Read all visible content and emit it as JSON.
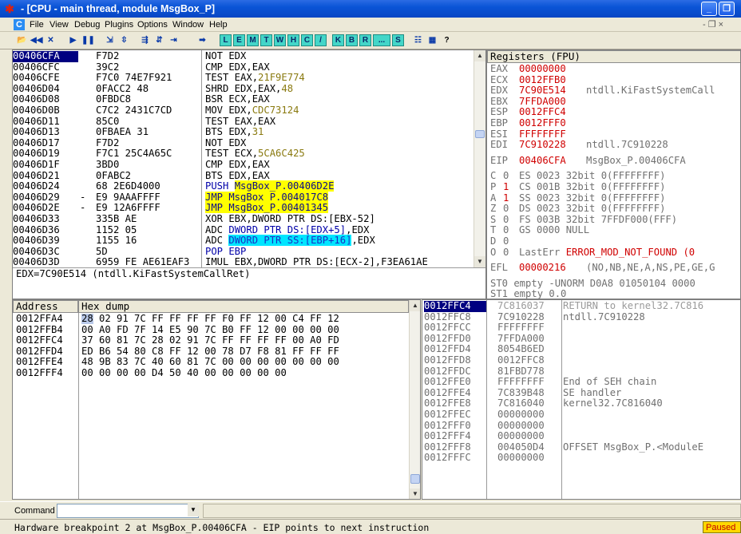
{
  "window": {
    "title": "- [CPU - main thread, module MsgBox_P]",
    "minimize_glyph": "_",
    "restore_glyph": "❐",
    "close_glyph": "✕",
    "app_icon_glyph": "✱"
  },
  "menu": {
    "items": [
      "File",
      "View",
      "Debug",
      "Plugins",
      "Options",
      "Window",
      "Help"
    ],
    "right_controls": "- ❐ ×"
  },
  "toolbar": {
    "buttons": [
      "open",
      "restart",
      "close",
      "run",
      "pause",
      "step-into",
      "step-over",
      "trace-into",
      "trace-over",
      "execute-till-return",
      "go-to"
    ],
    "glyphs": [
      "📂",
      "◀◀",
      "✕",
      "▶",
      "❚❚",
      "⇲",
      "⇳",
      "⇶",
      "⇵",
      "⇥",
      "➡"
    ],
    "letters": [
      "L",
      "E",
      "M",
      "T",
      "W",
      "H",
      "C",
      "/",
      "K",
      "B",
      "R",
      "...",
      "S"
    ],
    "extra_glyphs": [
      "☷",
      "▦",
      "?"
    ]
  },
  "disasm": {
    "addresses": [
      "00406CFA",
      "00406CFC",
      "00406CFE",
      "00406D04",
      "00406D08",
      "00406D0B",
      "00406D11",
      "00406D13",
      "00406D17",
      "00406D19",
      "00406D1F",
      "00406D21",
      "00406D24",
      "00406D29",
      "00406D2E",
      "00406D33",
      "00406D36",
      "00406D39",
      "00406D3C",
      "00406D3D"
    ],
    "jump_marks": [
      "",
      "",
      "",
      "",
      "",
      "",
      "",
      "",
      "",
      "",
      "",
      "",
      "",
      "-",
      "-",
      "",
      "",
      "",
      "",
      ""
    ],
    "hex": [
      "F7D2",
      "39C2",
      "F7C0 74E7F921",
      "0FACC2 48",
      "0FBDC8",
      "C7C2 2431C7CD",
      "85C0",
      "0FBAEA 31",
      "F7D2",
      "F7C1 25C4A65C",
      "3BD0",
      "0FABC2",
      "68 2E6D4000",
      "E9 9AAAFFFF",
      "E9 12A6FFFF",
      "335B AE",
      "1152 05",
      "1155 16",
      "5D",
      "6959 FE AE61EAF3"
    ],
    "instructions": [
      [
        {
          "t": "NOT EDX"
        }
      ],
      [
        {
          "t": "CMP EDX,EAX"
        }
      ],
      [
        {
          "t": "TEST EAX,"
        },
        {
          "t": "21F9E774",
          "c": "olive"
        }
      ],
      [
        {
          "t": "SHRD EDX,EAX,"
        },
        {
          "t": "48",
          "c": "olive"
        }
      ],
      [
        {
          "t": "BSR ECX,EAX"
        }
      ],
      [
        {
          "t": "MOV EDX,"
        },
        {
          "t": "CDC73124",
          "c": "olive"
        }
      ],
      [
        {
          "t": "TEST EAX,EAX"
        }
      ],
      [
        {
          "t": "BTS EDX,"
        },
        {
          "t": "31",
          "c": "olive"
        }
      ],
      [
        {
          "t": "NOT EDX"
        }
      ],
      [
        {
          "t": "TEST ECX,"
        },
        {
          "t": "5CA6C425",
          "c": "olive"
        }
      ],
      [
        {
          "t": "CMP EDX,EAX"
        }
      ],
      [
        {
          "t": "BTS EDX,EAX"
        }
      ],
      [
        {
          "t": "PUSH ",
          "c": "navy"
        },
        {
          "t": "MsgBox_P.00406D2E",
          "c": "hl-y"
        }
      ],
      [
        {
          "t": "JMP MsgBox_P.004017C8",
          "c": "hl-y"
        }
      ],
      [
        {
          "t": "JMP MsgBox_P.00401345",
          "c": "hl-y"
        }
      ],
      [
        {
          "t": "XOR EBX,DWORD PTR DS:[EBX-52]"
        }
      ],
      [
        {
          "t": "ADC "
        },
        {
          "t": "DWORD PTR DS:[EDX+5]",
          "c": "navy"
        },
        {
          "t": ",EDX"
        }
      ],
      [
        {
          "t": "ADC "
        },
        {
          "t": "DWORD PTR SS:[EBP+16]",
          "c": "hl-c"
        },
        {
          "t": ",EDX"
        }
      ],
      [
        {
          "t": "POP EBP",
          "c": "navy"
        }
      ],
      [
        {
          "t": "IMUL EBX,DWORD PTR DS:[ECX-2],F3EA61AE"
        }
      ]
    ],
    "info": "EDX=7C90E514 (ntdll.KiFastSystemCallRet)"
  },
  "registers": {
    "header": "Registers (FPU)",
    "regs": [
      {
        "name": "EAX",
        "val": "00000000",
        "note": ""
      },
      {
        "name": "ECX",
        "val": "0012FFB0",
        "note": ""
      },
      {
        "name": "EDX",
        "val": "7C90E514",
        "note": "ntdll.KiFastSystemCall"
      },
      {
        "name": "EBX",
        "val": "7FFDA000",
        "note": ""
      },
      {
        "name": "ESP",
        "val": "0012FFC4",
        "note": ""
      },
      {
        "name": "EBP",
        "val": "0012FFF0",
        "note": ""
      },
      {
        "name": "ESI",
        "val": "FFFFFFFF",
        "note": ""
      },
      {
        "name": "EDI",
        "val": "7C910228",
        "note": "ntdll.7C910228"
      }
    ],
    "eip": {
      "name": "EIP",
      "val": "00406CFA",
      "note": "MsgBox_P.00406CFA"
    },
    "flags": [
      {
        "f": "C",
        "v": "0",
        "seg": "ES 0023 32bit 0(FFFFFFFF)"
      },
      {
        "f": "P",
        "v": "1",
        "seg": "CS 001B 32bit 0(FFFFFFFF)"
      },
      {
        "f": "A",
        "v": "1",
        "seg": "SS 0023 32bit 0(FFFFFFFF)"
      },
      {
        "f": "Z",
        "v": "0",
        "seg": "DS 0023 32bit 0(FFFFFFFF)"
      },
      {
        "f": "S",
        "v": "0",
        "seg": "FS 003B 32bit 7FFDF000(FFF)"
      },
      {
        "f": "T",
        "v": "0",
        "seg": "GS 0000 NULL"
      },
      {
        "f": "D",
        "v": "0",
        "seg": ""
      },
      {
        "f": "O",
        "v": "0",
        "seg": "LastErr ERROR_MOD_NOT_FOUND (0"
      }
    ],
    "efl": {
      "name": "EFL",
      "val": "00000216",
      "note": "(NO,NB,NE,A,NS,PE,GE,G"
    },
    "fpu": [
      "ST0 empty -UNORM D0A8 01050104 0000",
      "ST1 empty 0.0"
    ]
  },
  "dump": {
    "col_address": "Address",
    "col_hex": "Hex dump",
    "rows": [
      {
        "addr": "0012FFA4",
        "hex": "28 02 91 7C FF FF FF FF F0 FF 12 00 C4 FF 12"
      },
      {
        "addr": "0012FFB4",
        "hex": "00 A0 FD 7F 14 E5 90 7C B0 FF 12 00 00 00 00"
      },
      {
        "addr": "0012FFC4",
        "hex": "37 60 81 7C 28 02 91 7C FF FF FF FF 00 A0 FD"
      },
      {
        "addr": "0012FFD4",
        "hex": "ED B6 54 80 C8 FF 12 00 78 D7 F8 81 FF FF FF"
      },
      {
        "addr": "0012FFE4",
        "hex": "48 9B 83 7C 40 60 81 7C 00 00 00 00 00 00 00"
      },
      {
        "addr": "0012FFF4",
        "hex": "00 00 00 00 D4 50 40 00 00 00 00 00"
      }
    ]
  },
  "stack": {
    "rows": [
      {
        "addr": "0012FFC4",
        "val": "7C816037",
        "note": "RETURN to kernel32.7C816"
      },
      {
        "addr": "0012FFC8",
        "val": "7C910228",
        "note": "ntdll.7C910228"
      },
      {
        "addr": "0012FFCC",
        "val": "FFFFFFFF",
        "note": ""
      },
      {
        "addr": "0012FFD0",
        "val": "7FFDA000",
        "note": ""
      },
      {
        "addr": "0012FFD4",
        "val": "8054B6ED",
        "note": ""
      },
      {
        "addr": "0012FFD8",
        "val": "0012FFC8",
        "note": ""
      },
      {
        "addr": "0012FFDC",
        "val": "81FBD778",
        "note": ""
      },
      {
        "addr": "0012FFE0",
        "val": "FFFFFFFF",
        "note": "End of SEH chain"
      },
      {
        "addr": "0012FFE4",
        "val": "7C839B48",
        "note": "SE handler"
      },
      {
        "addr": "0012FFE8",
        "val": "7C816040",
        "note": "kernel32.7C816040"
      },
      {
        "addr": "0012FFEC",
        "val": "00000000",
        "note": ""
      },
      {
        "addr": "0012FFF0",
        "val": "00000000",
        "note": ""
      },
      {
        "addr": "0012FFF4",
        "val": "00000000",
        "note": ""
      },
      {
        "addr": "0012FFF8",
        "val": "004050D4",
        "note": "OFFSET MsgBox_P.<ModuleE"
      },
      {
        "addr": "0012FFFC",
        "val": "00000000",
        "note": ""
      }
    ]
  },
  "command": {
    "label": "Command",
    "value": ""
  },
  "status": {
    "message": "Hardware breakpoint 2 at MsgBox_P.00406CFA - EIP points to next instruction",
    "state": "Paused"
  },
  "colors": {
    "selected_row": "#000080",
    "register_changed": "#d00000",
    "jump_highlight": "#ffff00",
    "stack_highlight": "#00e5ff",
    "paused_badge": "#ffd800"
  }
}
